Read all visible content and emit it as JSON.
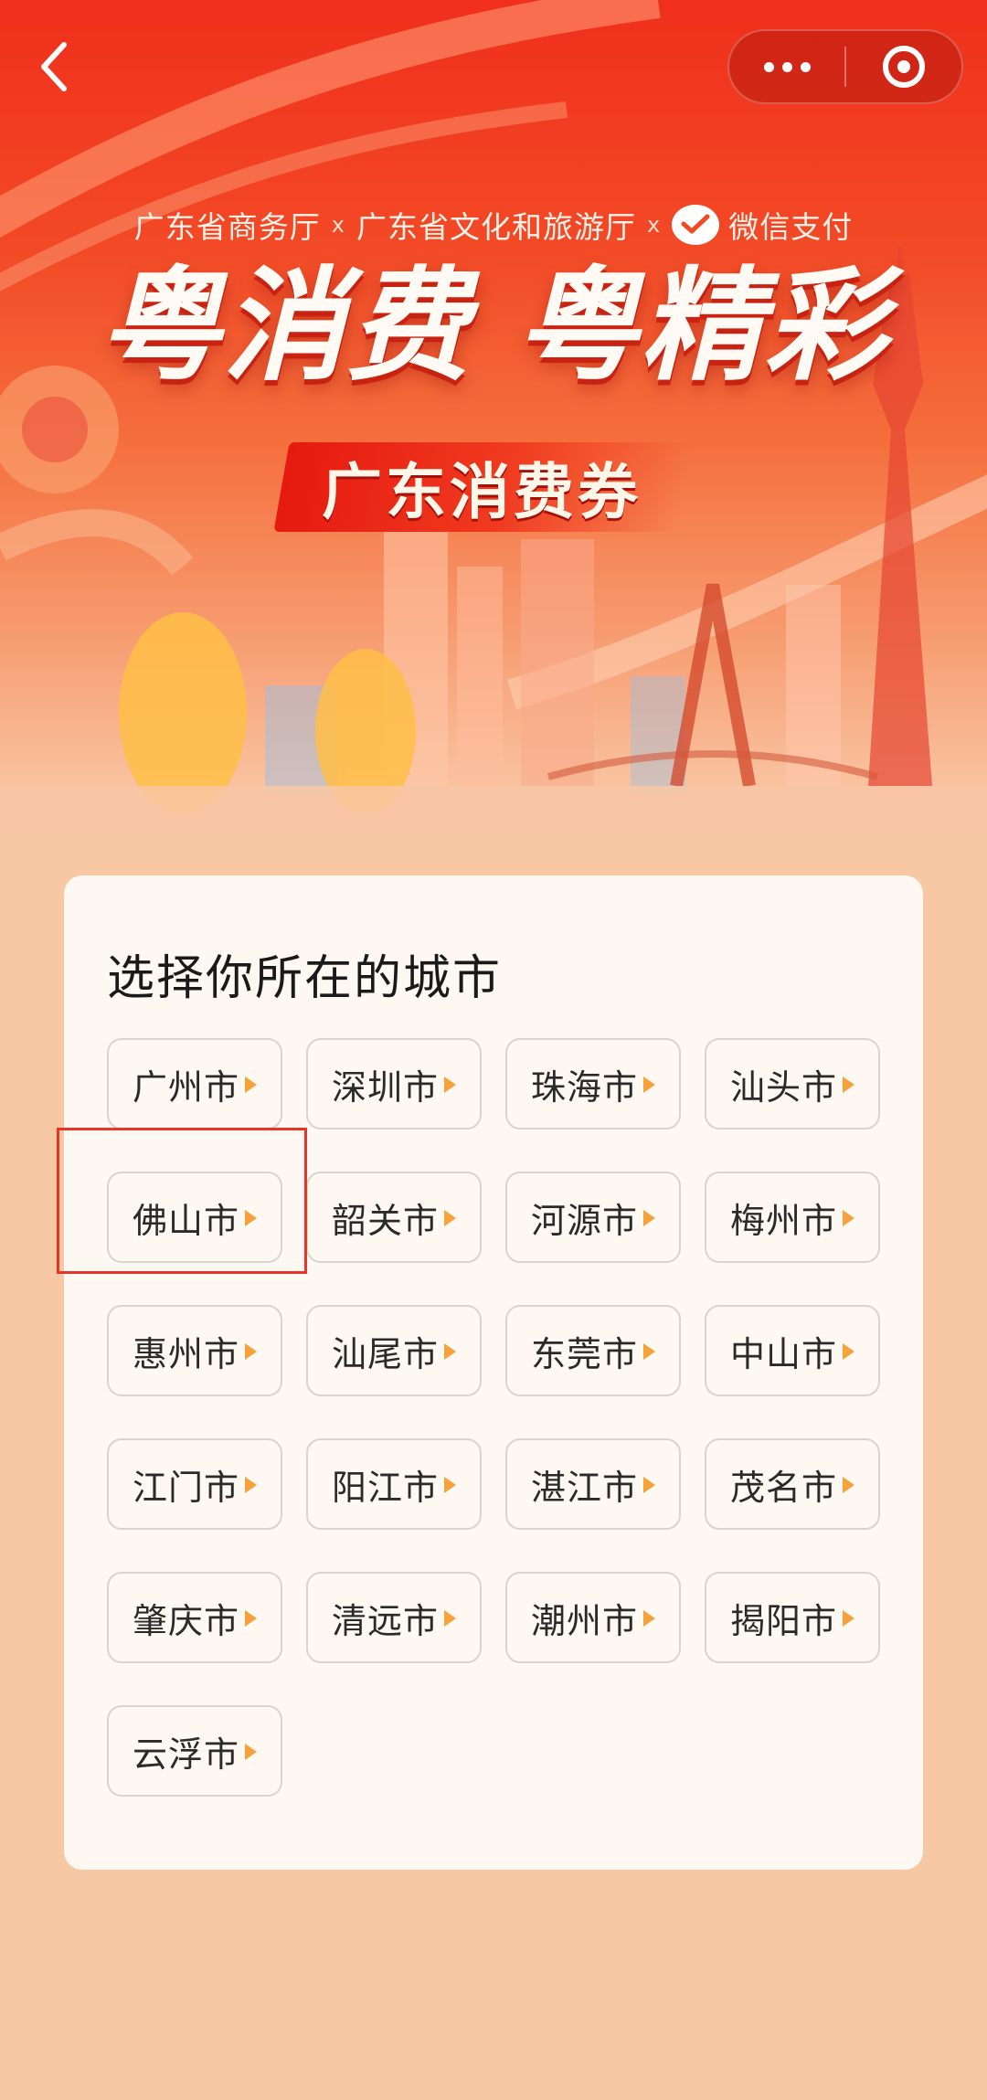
{
  "nav": {
    "back_icon": "chevron-left-icon",
    "more_icon": "more-dots-icon",
    "close_icon": "target-icon"
  },
  "banner": {
    "sponsor_1": "广东省商务厅",
    "separator": "x",
    "sponsor_2": "广东省文化和旅游厅",
    "sponsor_3": "微信支付",
    "headline": "粤消费 粤精彩",
    "subtitle": "广东消费券"
  },
  "city_picker": {
    "title": "选择你所在的城市",
    "cities": [
      "广州市",
      "深圳市",
      "珠海市",
      "汕头市",
      "佛山市",
      "韶关市",
      "河源市",
      "梅州市",
      "惠州市",
      "汕尾市",
      "东莞市",
      "中山市",
      "江门市",
      "阳江市",
      "湛江市",
      "茂名市",
      "肇庆市",
      "清远市",
      "潮州市",
      "揭阳市",
      "云浮市"
    ],
    "highlighted_city": "佛山市"
  },
  "colors": {
    "banner_red": "#f02f1c",
    "page_peach": "#f8c7a4",
    "card_bg": "#fdf8f2",
    "arrow_orange": "#f5a23c",
    "highlight_red": "#e8352a"
  }
}
